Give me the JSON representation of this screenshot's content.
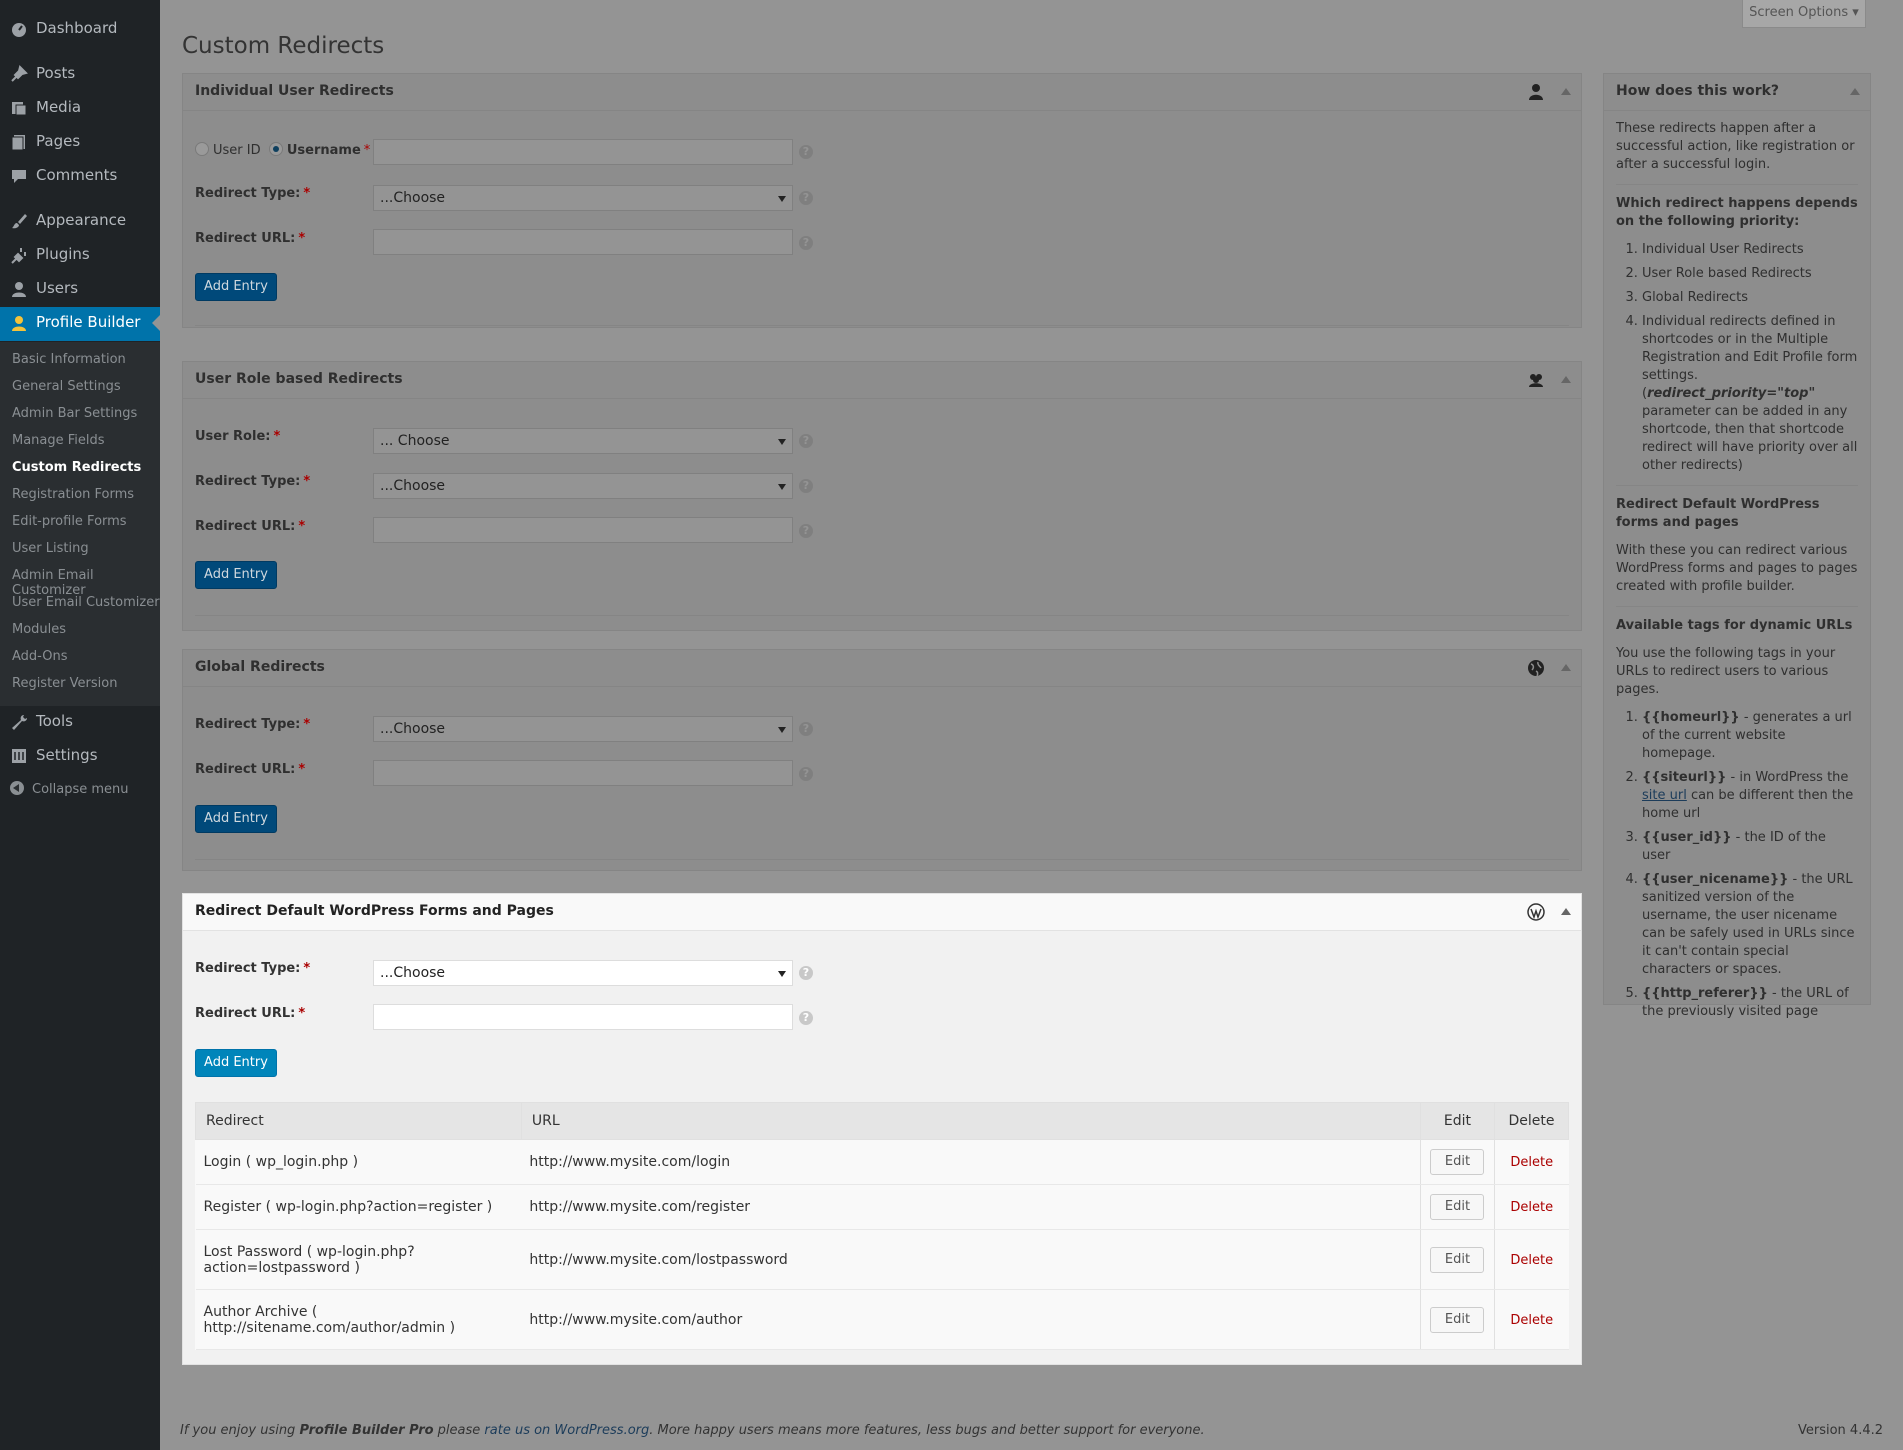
{
  "colors": {
    "sidebar_bg": "#1f2326",
    "accent": "#0073aa",
    "button_primary": "#0085ba",
    "delete": "#aa0000",
    "overlay": "#949494"
  },
  "sidebar": {
    "menu": [
      {
        "label": "Dashboard",
        "icon": "dashboard-icon"
      },
      {
        "label": "Posts",
        "icon": "pin-icon"
      },
      {
        "label": "Media",
        "icon": "media-icon"
      },
      {
        "label": "Pages",
        "icon": "pages-icon"
      },
      {
        "label": "Comments",
        "icon": "comment-icon"
      },
      {
        "label": "Appearance",
        "icon": "brush-icon"
      },
      {
        "label": "Plugins",
        "icon": "plug-icon"
      },
      {
        "label": "Users",
        "icon": "user-icon"
      },
      {
        "label": "Profile Builder",
        "icon": "profile-icon",
        "current": true
      }
    ],
    "submenu": [
      "Basic Information",
      "General Settings",
      "Admin Bar Settings",
      "Manage Fields",
      "Custom Redirects",
      "Registration Forms",
      "Edit-profile Forms",
      "User Listing",
      "Admin Email Customizer",
      "User Email Customizer",
      "Modules",
      "Add-Ons",
      "Register Version"
    ],
    "submenu_current": "Custom Redirects",
    "menu_bottom": [
      {
        "label": "Tools",
        "icon": "wrench-icon"
      },
      {
        "label": "Settings",
        "icon": "settings-icon"
      }
    ],
    "collapse": "Collapse menu"
  },
  "header": {
    "title": "Custom Redirects",
    "screen_options": "Screen Options"
  },
  "common": {
    "required": "*",
    "help": "?",
    "add_entry": "Add Entry",
    "choose": "...Choose",
    "choose_spaced": "... Choose"
  },
  "individual": {
    "title": "Individual User Redirects",
    "radio_user_id": "User ID",
    "radio_username": "Username",
    "redirect_type": "Redirect Type:",
    "redirect_url": "Redirect URL:"
  },
  "role": {
    "title": "User Role based Redirects",
    "user_role": "User Role:",
    "redirect_type": "Redirect Type:",
    "redirect_url": "Redirect URL:"
  },
  "global": {
    "title": "Global Redirects",
    "redirect_type": "Redirect Type:",
    "redirect_url": "Redirect URL:"
  },
  "default_forms": {
    "title": "Redirect Default WordPress Forms and Pages",
    "redirect_type": "Redirect Type:",
    "redirect_url": "Redirect URL:",
    "table": {
      "headers": {
        "redirect": "Redirect",
        "url": "URL",
        "edit": "Edit",
        "delete": "Delete"
      },
      "rows": [
        {
          "redirect": "Login ( wp_login.php )",
          "url": "http://www.mysite.com/login",
          "edit": "Edit",
          "delete": "Delete"
        },
        {
          "redirect": "Register ( wp-login.php?action=register )",
          "url": "http://www.mysite.com/register",
          "edit": "Edit",
          "delete": "Delete"
        },
        {
          "redirect": "Lost Password ( wp-login.php? action=lostpassword )",
          "url": "http://www.mysite.com/lostpassword",
          "edit": "Edit",
          "delete": "Delete"
        },
        {
          "redirect": "Author Archive ( http://sitename.com/author/admin )",
          "url": "http://www.mysite.com/author",
          "edit": "Edit",
          "delete": "Delete"
        }
      ]
    }
  },
  "help_box": {
    "title": "How does this work?",
    "intro": "These redirects happen after a successful action, like registration or after a successful login.",
    "priority_heading": "Which redirect happens depends on the following priority:",
    "priority_list": [
      "Individual User Redirects",
      "User Role based Redirects",
      "Global Redirects"
    ],
    "priority_item4_a": "Individual redirects defined in shortcodes or in the Multiple Registration and Edit Profile form settings. (",
    "priority_item4_code": "redirect_priority=\"top\"",
    "priority_item4_b": " parameter can be added in any shortcode, then that shortcode redirect will have priority over all other redirects)",
    "default_heading": "Redirect Default WordPress forms and pages",
    "default_text": "With these you can redirect various WordPress forms and pages to pages created with profile builder.",
    "tags_heading": "Available tags for dynamic URLs",
    "tags_intro": "You use the following tags in your URLs to redirect users to various pages.",
    "tags": [
      {
        "tag": "{{homeurl}}",
        "desc": " - generates a url of the current website homepage."
      },
      {
        "tag": "{{siteurl}}",
        "desc": " - in WordPress the ",
        "link": "site url",
        "desc2": " can be different then the home url"
      },
      {
        "tag": "{{user_id}}",
        "desc": " - the ID of the user"
      },
      {
        "tag": "{{user_nicename}}",
        "desc": " - the URL sanitized version of the username, the user nicename can be safely used in URLs since it can't contain special characters or spaces."
      },
      {
        "tag": "{{http_referer}}",
        "desc": " - the URL of the previously visited page"
      }
    ]
  },
  "footer": {
    "pre": "If you enjoy using ",
    "product": "Profile Builder Pro",
    "mid": " please ",
    "link": "rate us on WordPress.org",
    "post": ". More happy users means more features, less bugs and better support for everyone.",
    "version": "Version 4.4.2"
  }
}
